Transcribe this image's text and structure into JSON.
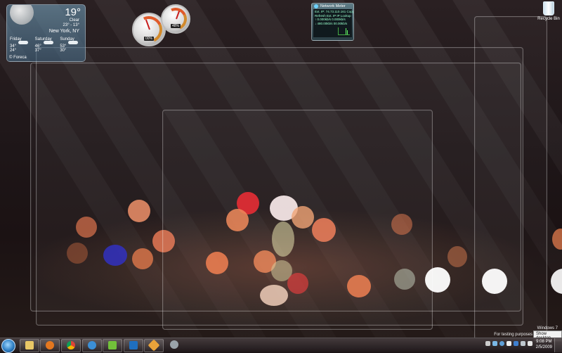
{
  "weather": {
    "temperature": "19°",
    "condition": "Clear",
    "range": "23° - 13°",
    "city": "New York, NY",
    "forecast": [
      {
        "day": "Friday",
        "high": "34°",
        "low": "24°"
      },
      {
        "day": "Saturday",
        "high": "46°",
        "low": "37°"
      },
      {
        "day": "Sunday",
        "high": "53°",
        "low": "30°"
      }
    ],
    "credit": "© Foreca"
  },
  "gauges": {
    "cpu_readout": "00%",
    "memory_readout": "48%"
  },
  "network_meter": {
    "title": "Network Meter",
    "lines": [
      "Ext. IP: 74.73.110.161   Copy",
      "Refresh Ext. IP    IP Lookup",
      "↑ 0.000kb/s    0.000kb/s",
      "↓ 480.00kb/s   00.00kb/s"
    ]
  },
  "desktop": {
    "recycle_bin_label": "Recycle Bin",
    "watermark_line1": "Windows 7",
    "watermark_line2": "For testing purposes",
    "show_desktop_tooltip": "Show desktop"
  },
  "taskbar": {
    "pinned": [
      {
        "name": "explorer",
        "color": "#e8c766"
      },
      {
        "name": "firefox",
        "color": "#e3771f"
      },
      {
        "name": "chrome",
        "color": "#3aa757"
      },
      {
        "name": "ie",
        "color": "#3b8fd6"
      },
      {
        "name": "messenger",
        "color": "#72c13a"
      },
      {
        "name": "photoshop",
        "color": "#1f6fbf"
      },
      {
        "name": "utility",
        "color": "#e9a33a"
      },
      {
        "name": "chat",
        "color": "#9aa3aa"
      }
    ],
    "clock_time": "9:08 PM",
    "clock_date": "2/5/2009"
  },
  "colors": {
    "accent": "#2f7fc4",
    "taskbar": "#2a2224"
  }
}
